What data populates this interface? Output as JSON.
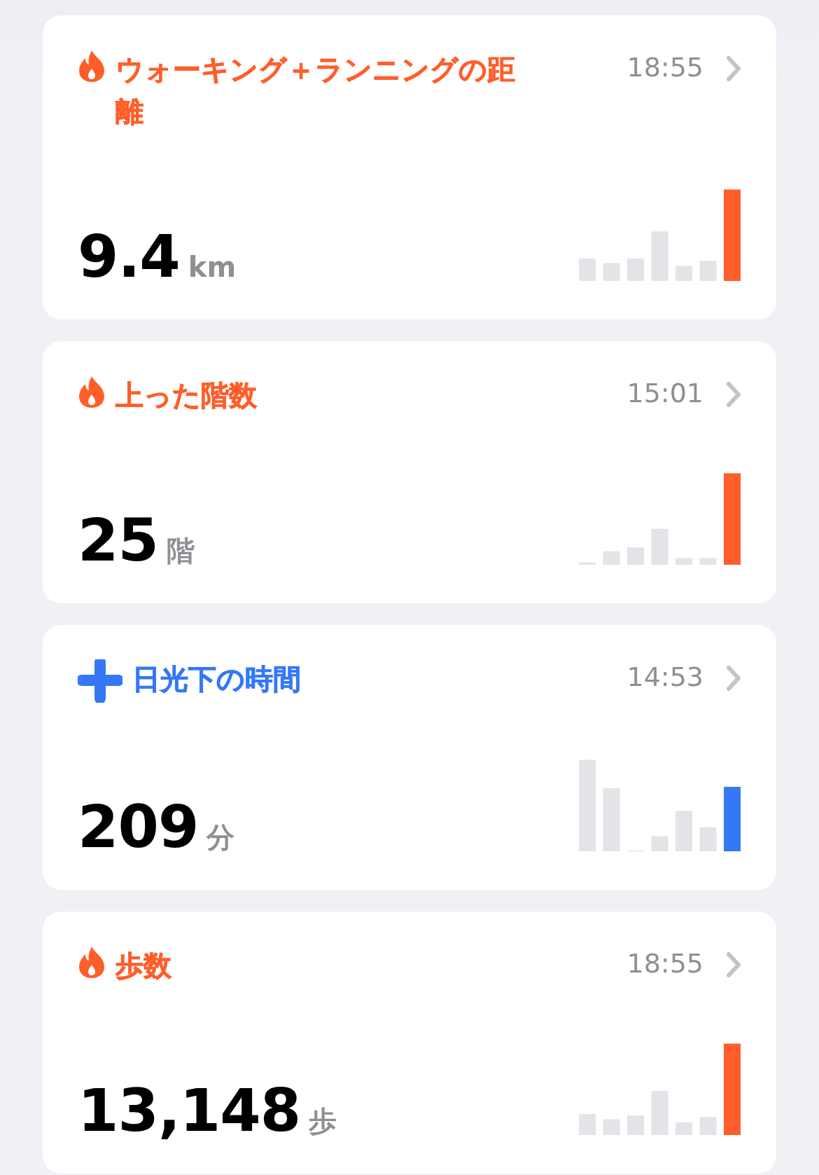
{
  "cards": [
    {
      "kind": "flame",
      "color": "#ff5e2a",
      "title": "ウォーキング＋ランニングの距離",
      "time": "18:55",
      "value": "9.4",
      "unit": "km"
    },
    {
      "kind": "flame",
      "color": "#ff5e2a",
      "title": "上った階数",
      "time": "15:01",
      "value": "25",
      "unit": "階"
    },
    {
      "kind": "plus",
      "color": "#3478f6",
      "title": "日光下の時間",
      "time": "14:53",
      "value": "209",
      "unit": "分"
    },
    {
      "kind": "flame",
      "color": "#ff5e2a",
      "title": "歩数",
      "time": "18:55",
      "value": "13,148",
      "unit": "歩"
    }
  ]
}
